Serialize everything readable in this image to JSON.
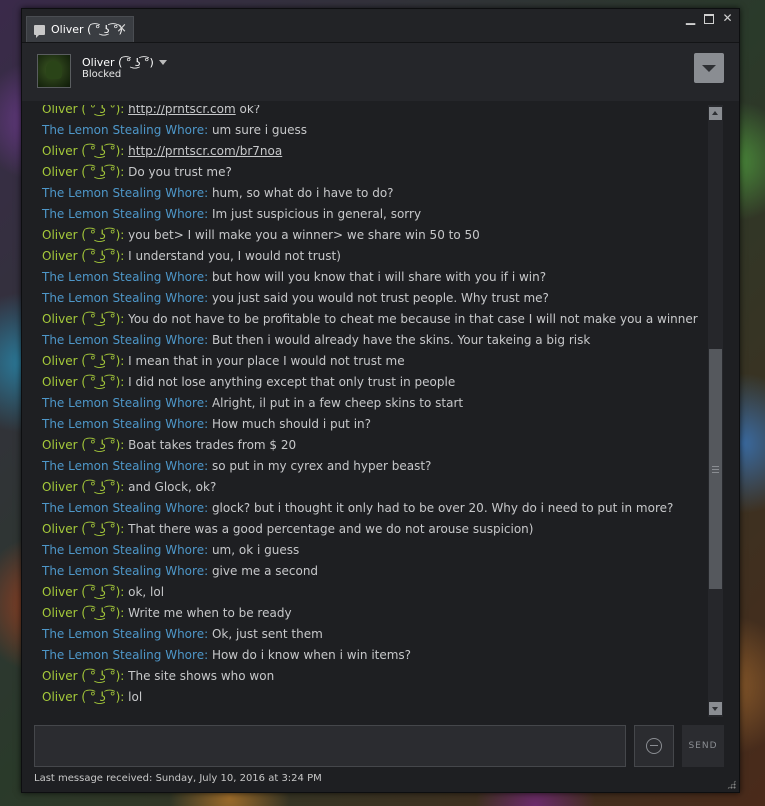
{
  "tab": {
    "label": "Oliver ( ͡° ͜ʖ ͡°)",
    "close": "×"
  },
  "window_controls": {
    "minimize": "▁",
    "maximize": "",
    "close": "✕"
  },
  "header": {
    "name": "Oliver ( ͡° ͜ʖ ͡°)",
    "status": "Blocked"
  },
  "messages": [
    {
      "sender": "Oliver ( ͡° ͜ʖ ͡°)",
      "who": "oliver",
      "text": "",
      "link": "http://prntscr.com",
      "tail": " ok?"
    },
    {
      "sender": "The Lemon Stealing Whore",
      "who": "lemon",
      "text": "um sure i guess"
    },
    {
      "sender": "Oliver ( ͡° ͜ʖ ͡°)",
      "who": "oliver",
      "text": "",
      "link": "http://prntscr.com/br7noa",
      "tail": ""
    },
    {
      "sender": "Oliver ( ͡° ͜ʖ ͡°)",
      "who": "oliver",
      "text": "Do you trust me?"
    },
    {
      "sender": "The Lemon Stealing Whore",
      "who": "lemon",
      "text": "hum, so what do i have to do?"
    },
    {
      "sender": "The Lemon Stealing Whore",
      "who": "lemon",
      "text": "Im just suspicious in general, sorry"
    },
    {
      "sender": "Oliver ( ͡° ͜ʖ ͡°)",
      "who": "oliver",
      "text": "you bet> I will make you a winner> we share win 50 to 50"
    },
    {
      "sender": "Oliver ( ͡° ͜ʖ ͡°)",
      "who": "oliver",
      "text": "I understand you, I would not trust)"
    },
    {
      "sender": "The Lemon Stealing Whore",
      "who": "lemon",
      "text": "but how will you know that i will share with you if i win?"
    },
    {
      "sender": "The Lemon Stealing Whore",
      "who": "lemon",
      "text": "you just said you would not trust people. Why trust me?"
    },
    {
      "sender": "Oliver ( ͡° ͜ʖ ͡°)",
      "who": "oliver",
      "text": "You do not have to be profitable to cheat me because in that case I will not make you a winner"
    },
    {
      "sender": "The Lemon Stealing Whore",
      "who": "lemon",
      "text": "But then i would already have the skins. Your takeing a big risk"
    },
    {
      "sender": "Oliver ( ͡° ͜ʖ ͡°)",
      "who": "oliver",
      "text": "I mean that in your place I would not trust me"
    },
    {
      "sender": "Oliver ( ͡° ͜ʖ ͡°)",
      "who": "oliver",
      "text": "I did not lose anything except that only trust in people"
    },
    {
      "sender": "The Lemon Stealing Whore",
      "who": "lemon",
      "text": "Alright, il put in a few cheep skins to start"
    },
    {
      "sender": "The Lemon Stealing Whore",
      "who": "lemon",
      "text": "How much should i put in?"
    },
    {
      "sender": "Oliver ( ͡° ͜ʖ ͡°)",
      "who": "oliver",
      "text": "Boat takes trades from $ 20"
    },
    {
      "sender": "The Lemon Stealing Whore",
      "who": "lemon",
      "text": "so put in my cyrex and hyper beast?"
    },
    {
      "sender": "Oliver ( ͡° ͜ʖ ͡°)",
      "who": "oliver",
      "text": "and Glock, ok?"
    },
    {
      "sender": "The Lemon Stealing Whore",
      "who": "lemon",
      "text": "glock? but i thought it only had to be over 20. Why do i need to put in more?"
    },
    {
      "sender": "Oliver ( ͡° ͜ʖ ͡°)",
      "who": "oliver",
      "text": "That there was a good percentage and we do not arouse suspicion)"
    },
    {
      "sender": "The Lemon Stealing Whore",
      "who": "lemon",
      "text": "um, ok i guess"
    },
    {
      "sender": "The Lemon Stealing Whore",
      "who": "lemon",
      "text": "give me a second"
    },
    {
      "sender": "Oliver ( ͡° ͜ʖ ͡°)",
      "who": "oliver",
      "text": "ok, lol"
    },
    {
      "sender": "Oliver ( ͡° ͜ʖ ͡°)",
      "who": "oliver",
      "text": "Write me when to be ready"
    },
    {
      "sender": "The Lemon Stealing Whore",
      "who": "lemon",
      "text": "Ok, just sent them"
    },
    {
      "sender": "The Lemon Stealing Whore",
      "who": "lemon",
      "text": "How do i know when i win items?"
    },
    {
      "sender": "Oliver ( ͡° ͜ʖ ͡°)",
      "who": "oliver",
      "text": "The site shows who won"
    },
    {
      "sender": "Oliver ( ͡° ͜ʖ ͡°)",
      "who": "oliver",
      "text": "lol"
    }
  ],
  "scroll_position": 0.78,
  "input": {
    "value": "",
    "placeholder": ""
  },
  "send_label": "SEND",
  "footer": {
    "last_received": "Last message received: Sunday, July 10, 2016 at 3:24 PM"
  },
  "colors": {
    "sender_oliver": "#a5c93a",
    "sender_lemon": "#4e97c9",
    "message_text": "#c7c8ca",
    "window_bg": "#1e1f22"
  }
}
